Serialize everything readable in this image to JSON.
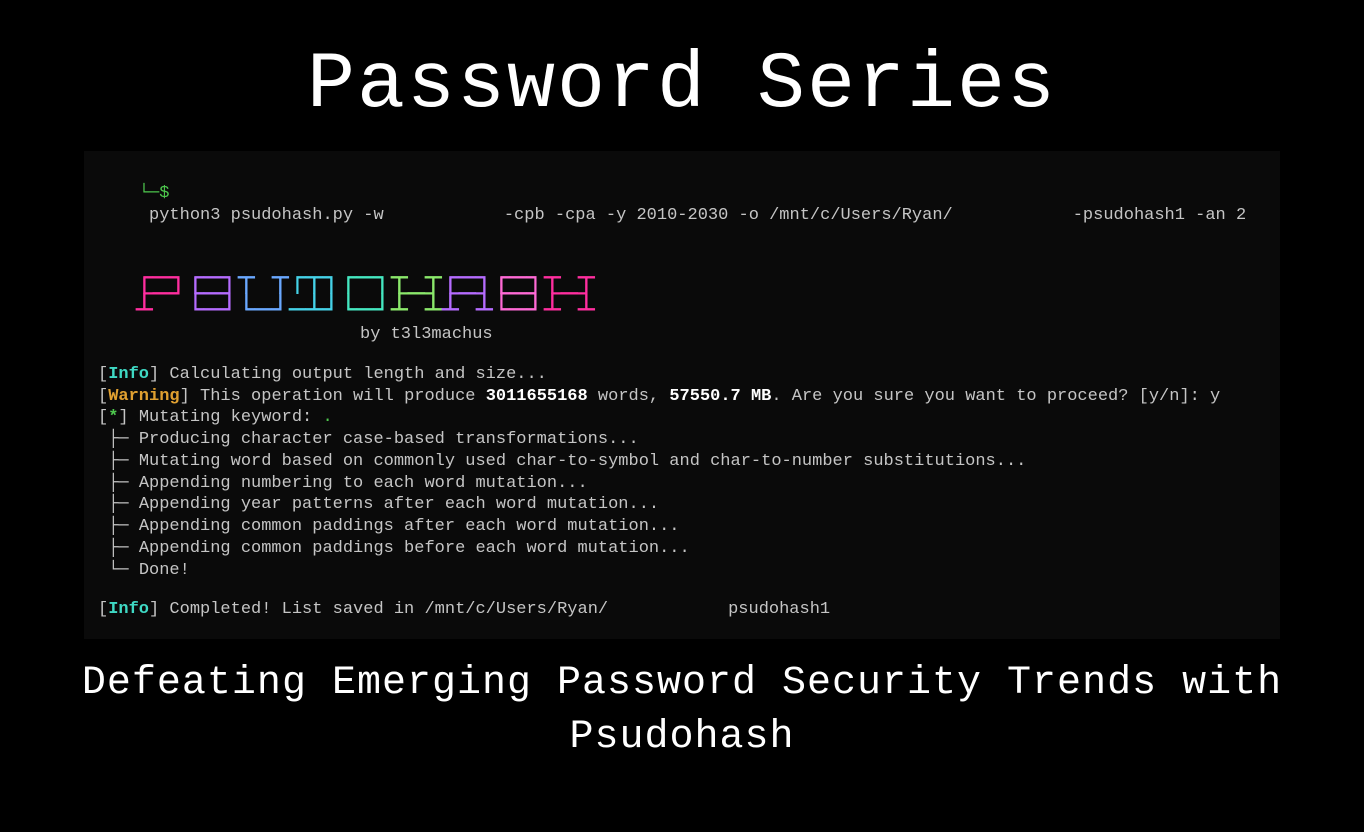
{
  "page": {
    "title": "Password Series",
    "subtitle": "Defeating Emerging Password Security Trends with Psudohash"
  },
  "terminal": {
    "prompt_prefix": "└─$",
    "command_part1": "python3 psudohash.py -w ",
    "command_part2": "-cpb -cpa -y 2010-2030 -o /mnt/c/Users/Ryan/",
    "command_part3": "-psudohash1 -an 2",
    "logo_name": "PSUDOHASH",
    "byline": "by t3l3machus",
    "info_label": "Info",
    "warning_label": "Warning",
    "star_label": "*",
    "calc_text": "Calculating output length and size...",
    "warn_pre": "This operation will produce ",
    "warn_words_num": "3011655168",
    "warn_words_label": " words, ",
    "warn_size_num": "57550.7 MB",
    "warn_post": ". Are you sure you want to proceed? [y/n]: y",
    "mutating_text": "Mutating keyword: ",
    "steps": [
      "Producing character case-based transformations...",
      "Mutating word based on commonly used char-to-symbol and char-to-number substitutions...",
      "Appending numbering to each word mutation...",
      "Appending year patterns after each word mutation...",
      "Appending common paddings after each word mutation...",
      "Appending common paddings before each word mutation...",
      "Done!"
    ],
    "completed_pre": "Completed! List saved in /mnt/c/Users/Ryan/",
    "completed_post": "psudohash1"
  }
}
